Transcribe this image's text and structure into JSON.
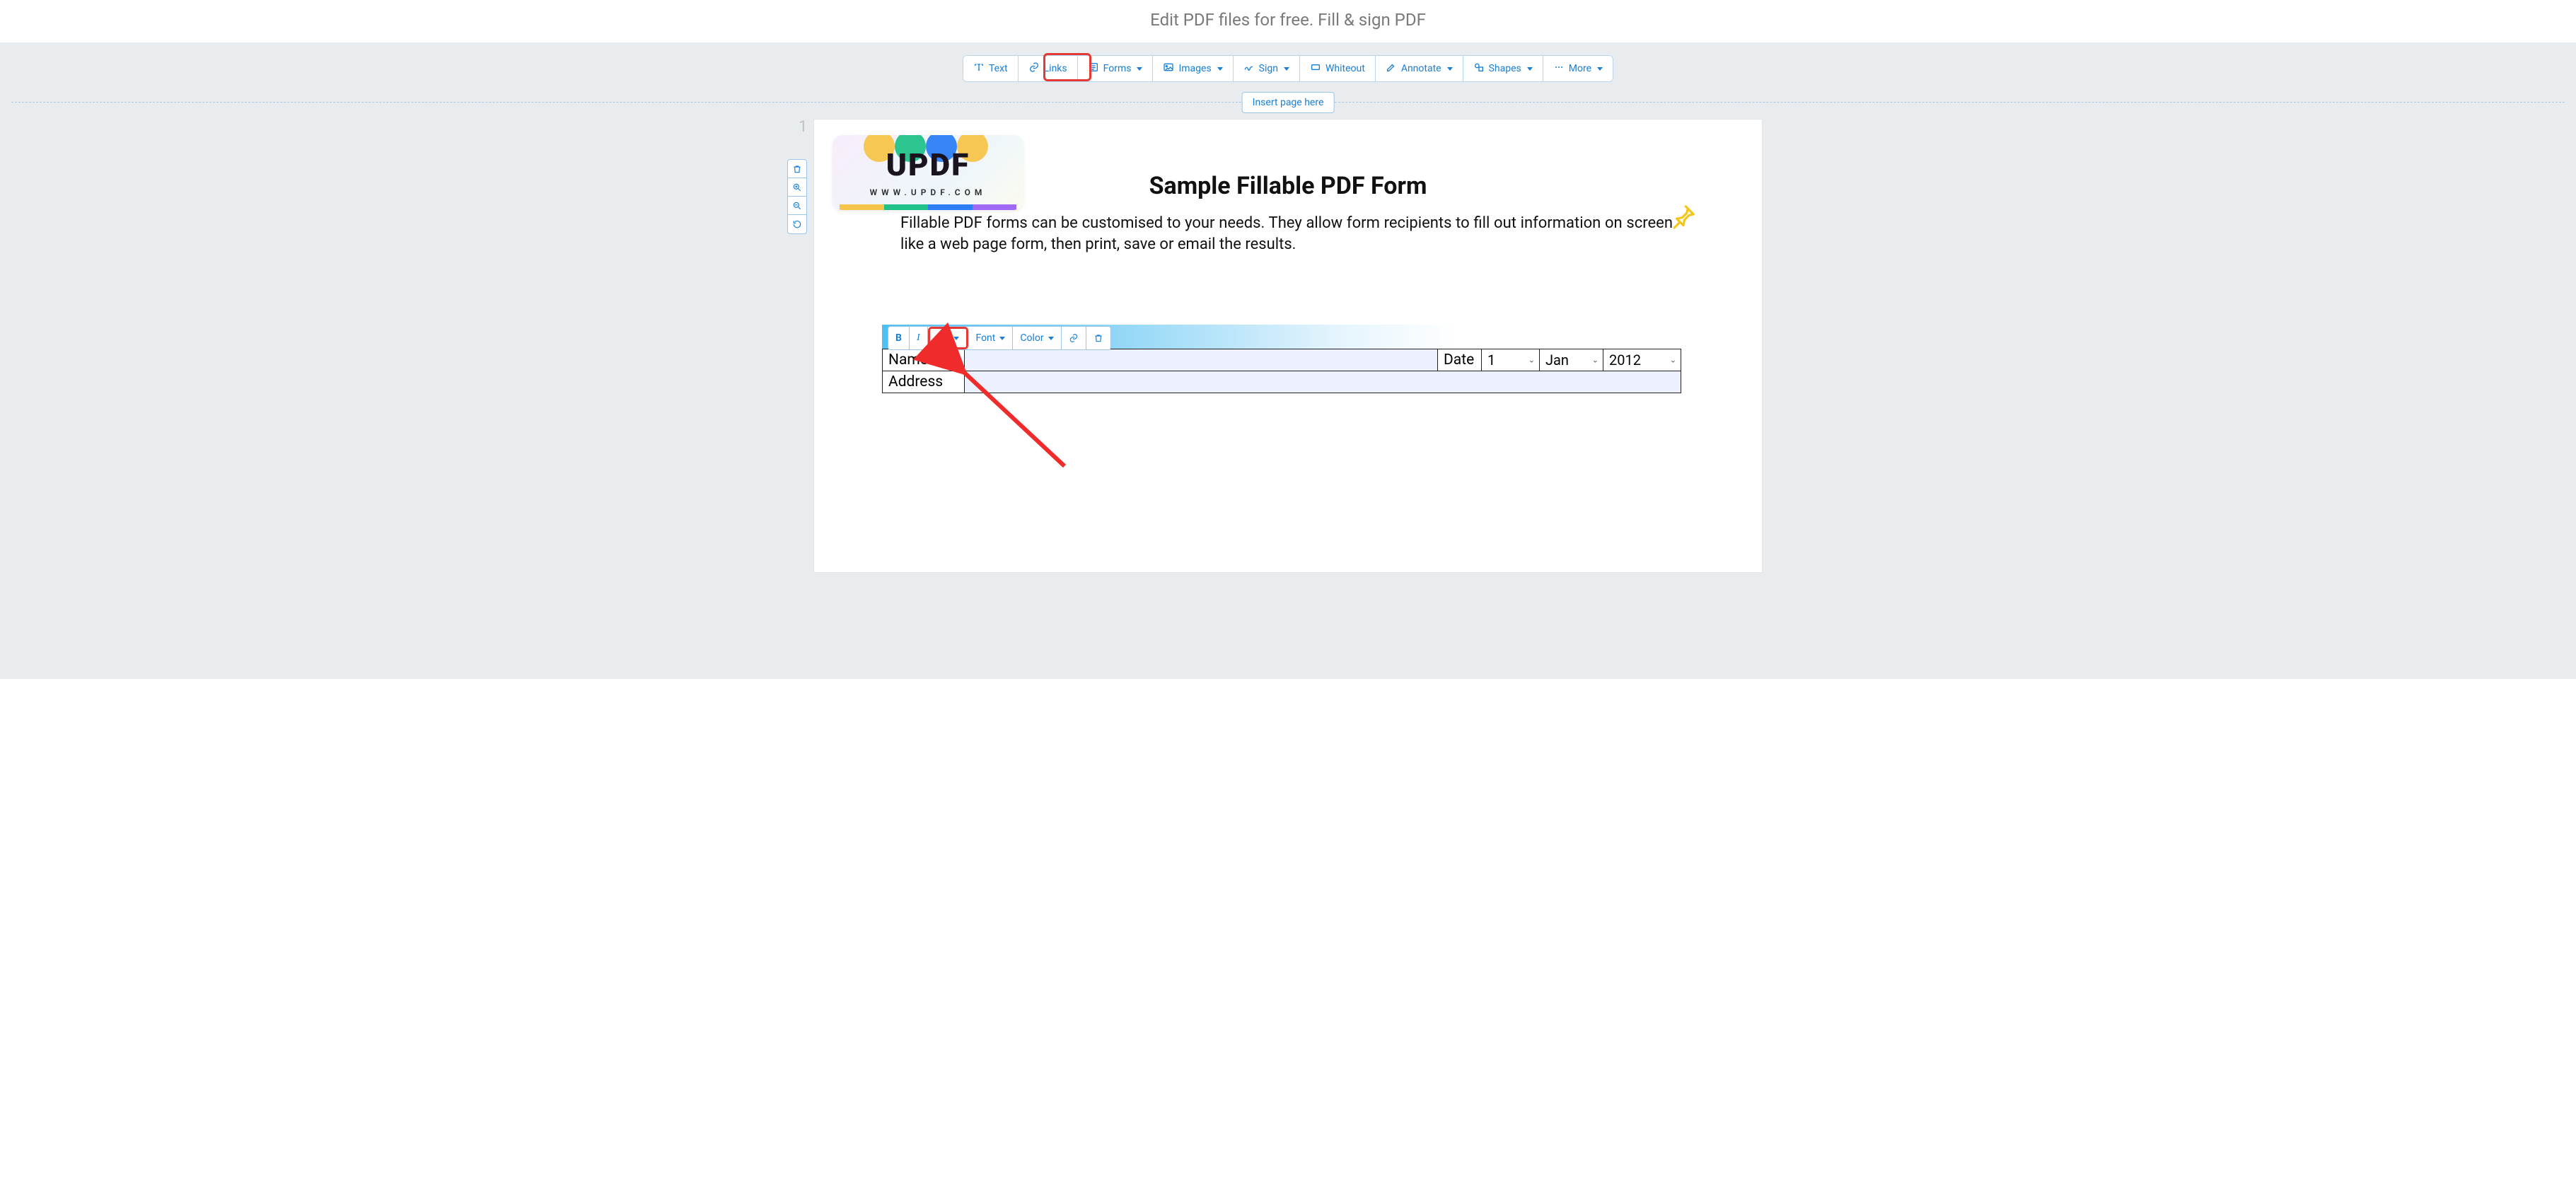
{
  "header": {
    "title": "Edit PDF files for free. Fill & sign PDF"
  },
  "toolbar": {
    "text": "Text",
    "links": "Links",
    "forms": "Forms",
    "images": "Images",
    "sign": "Sign",
    "whiteout": "Whiteout",
    "annotate": "Annotate",
    "shapes": "Shapes",
    "more": "More"
  },
  "insert": {
    "label": "Insert page here"
  },
  "page": {
    "number": "1"
  },
  "logo": {
    "text": "UPDF",
    "url": "WWW.UPDF.COM"
  },
  "doc": {
    "title": "Sample Fillable PDF Form",
    "paragraph": "Fillable PDF forms can be customised to your needs. They allow form recipients to fill out information on screen like a web page form, then print, save or email the results."
  },
  "fmt": {
    "bold": "B",
    "italic": "I",
    "size": "T",
    "font": "Font",
    "color": "Color"
  },
  "form": {
    "name_label": "Name",
    "address_label": "Address",
    "date_label": "Date",
    "day": "1",
    "month": "Jan",
    "year": "2012"
  },
  "colors": {
    "accent": "#1a7fd6",
    "highlight": "#e53935",
    "pin": "#f5c518"
  }
}
